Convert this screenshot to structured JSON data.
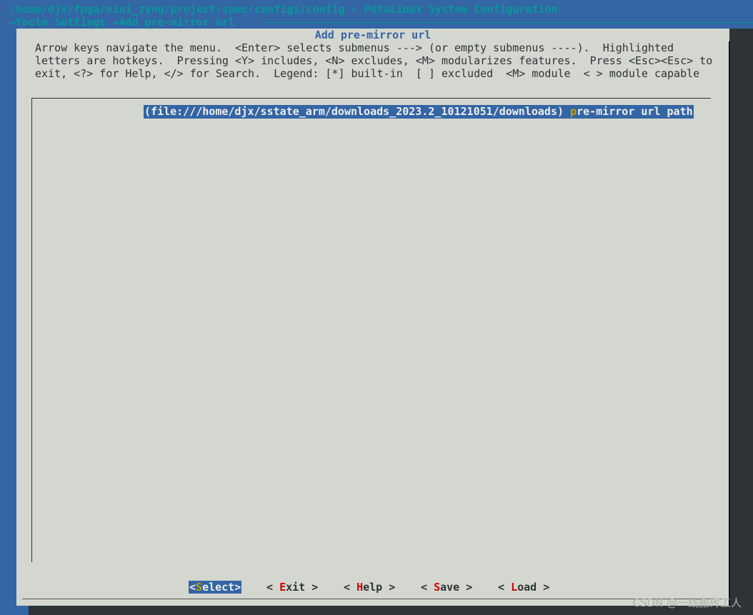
{
  "window": {
    "path_title": "/home/djx/fpga/mini_zynq/project-spec/configs/config - PetaLinux System Configuration",
    "breadcrumb": "→Yocto Settings →Add pre-mirror url"
  },
  "dialog": {
    "title": "Add pre-mirror url",
    "help_lines": [
      "Arrow keys navigate the menu.  <Enter> selects submenus ---> (or empty submenus ----).  Highlighted",
      "letters are hotkeys.  Pressing <Y> includes, <N> excludes, <M> modularizes features.  Press <Esc><Esc> to",
      "exit, <?> for Help, </> for Search.  Legend: [*] built-in  [ ] excluded  <M> module  < > module capable"
    ]
  },
  "menu": {
    "items": [
      {
        "open": "(",
        "value_first": "f",
        "value_rest": "ile:///home/djx/sstate_arm/downloads_2023.2_10121051/downloads",
        "close": ") ",
        "hotkey": "p",
        "label_rest": "re-mirror url path",
        "selected": true
      }
    ]
  },
  "buttons": [
    {
      "pre": "<",
      "hotkey": "S",
      "rest": "elect",
      "post": ">",
      "selected": true
    },
    {
      "pre": "< ",
      "hotkey": "E",
      "rest": "xit",
      "post": " >",
      "selected": false
    },
    {
      "pre": "< ",
      "hotkey": "H",
      "rest": "elp",
      "post": " >",
      "selected": false
    },
    {
      "pre": "< ",
      "hotkey": "S",
      "rest": "ave",
      "post": " >",
      "selected": false
    },
    {
      "pre": "< ",
      "hotkey": "L",
      "rest": "oad",
      "post": " >",
      "selected": false
    }
  ],
  "watermark": "CSDN @一线搬砖工人",
  "colors": {
    "terminal_bg": "#3465a4",
    "dialog_bg": "#d3d7cf",
    "title_cyan": "#06989a",
    "highlight_bg": "#3465a4",
    "hotkey_red": "#cc0000",
    "hotkey_yellow": "#c4a000"
  }
}
